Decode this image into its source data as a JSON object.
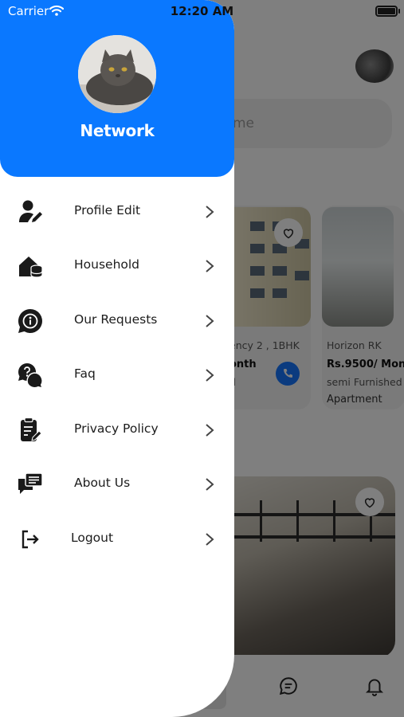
{
  "status_bar": {
    "carrier": "Carrier",
    "time": "12:20 AM"
  },
  "drawer": {
    "title": "Network",
    "menu": [
      {
        "label": "Profile Edit",
        "icon": "user-edit-icon"
      },
      {
        "label": "Household",
        "icon": "house-database-icon"
      },
      {
        "label": "Our Requests",
        "icon": "info-chat-icon"
      },
      {
        "label": "Faq",
        "icon": "question-chat-icon"
      },
      {
        "label": "Privacy Policy",
        "icon": "clipboard-edit-icon"
      },
      {
        "label": "About Us",
        "icon": "chat-text-icon"
      },
      {
        "label": "Logout",
        "icon": "logout-icon"
      }
    ]
  },
  "background": {
    "search_placeholder_fragment": "me",
    "listings": [
      {
        "name": "ency 2 , 1BHK",
        "price": "onth",
        "furnishing": "d"
      },
      {
        "name": "Horizon RK",
        "price": "Rs.9500/ Mont",
        "furnishing": "semi Furnished",
        "type": "Apartment"
      }
    ]
  },
  "colors": {
    "header_blue": "#0a78ff",
    "call_blue": "#1677ff",
    "overlay": "rgba(0,0,0,0.5)"
  }
}
